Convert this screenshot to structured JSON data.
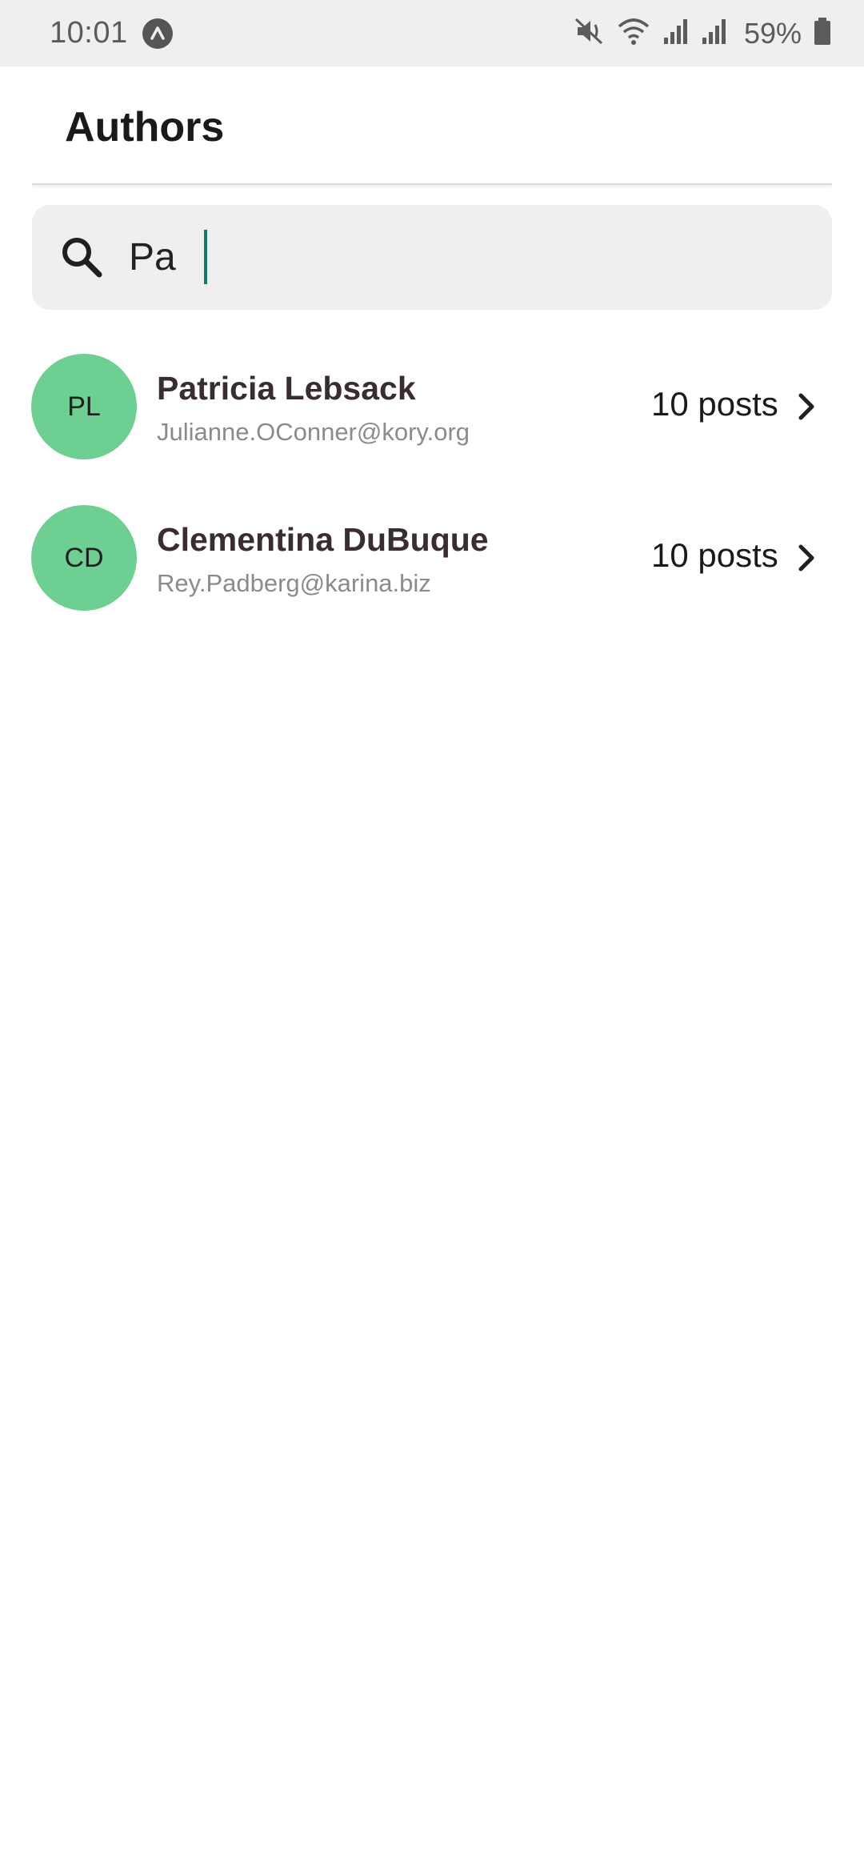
{
  "status_bar": {
    "time": "10:01",
    "battery": "59%",
    "icons": [
      "app-notification-icon",
      "mute-vibrate-icon",
      "wifi-icon",
      "signal-icon",
      "signal-icon",
      "battery-icon"
    ]
  },
  "header": {
    "title": "Authors"
  },
  "search": {
    "value": "Pa",
    "icon": "search-icon",
    "cursor_color": "#0f7d6a"
  },
  "authors": [
    {
      "initials": "PL",
      "name": "Patricia Lebsack",
      "email": "Julianne.OConner@kory.org",
      "posts": "10 posts"
    },
    {
      "initials": "CD",
      "name": "Clementina DuBuque",
      "email": "Rey.Padberg@karina.biz",
      "posts": "10 posts"
    }
  ],
  "colors": {
    "avatar": "#6ecf93",
    "search_bg": "#efefef",
    "status_bg": "#efefef"
  }
}
